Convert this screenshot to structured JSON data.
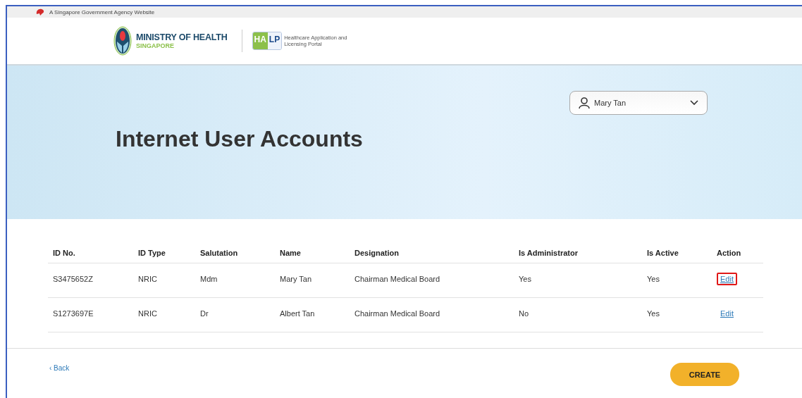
{
  "masthead": {
    "text": "A Singapore Government Agency Website"
  },
  "header": {
    "ministry": "MINISTRY OF HEALTH",
    "ministry_sub": "SINGAPORE",
    "portal_badge": [
      "HA",
      "LP"
    ],
    "portal_name": "Healthcare Application and Licensing Portal"
  },
  "user_menu": {
    "name": "Mary Tan",
    "expanded": false
  },
  "page_title": "Internet User Accounts",
  "table": {
    "columns": [
      "ID No.",
      "ID Type",
      "Salutation",
      "Name",
      "Designation",
      "Is Administrator",
      "Is Active",
      "Action"
    ],
    "rows": [
      {
        "cells": [
          "S3475652Z",
          "NRIC",
          "Mdm",
          "Mary Tan",
          "Chairman Medical Board",
          "Yes",
          "Yes"
        ],
        "action": "Edit",
        "highlighted": true
      },
      {
        "cells": [
          "S1273697E",
          "NRIC",
          "Dr",
          "Albert Tan",
          "Chairman Medical Board",
          "No",
          "Yes"
        ],
        "action": "Edit",
        "highlighted": false
      }
    ]
  },
  "back_link": "‹ Back",
  "create_button": "CREATE"
}
